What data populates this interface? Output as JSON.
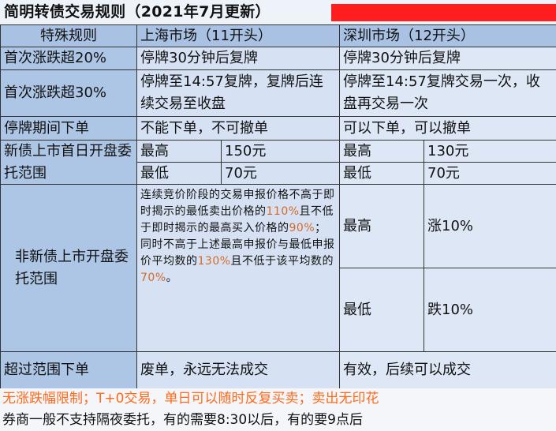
{
  "title": "简明转债交易规则（2021年7月更新）",
  "header": {
    "col1": "特殊规则",
    "col2": "上海市场（11开头）",
    "col3": "深圳市场（12开头）"
  },
  "rows": {
    "r20": {
      "label": "首次涨跌超20%",
      "sh": "停牌30分钟后复牌",
      "sz": "停牌30分钟后复牌"
    },
    "r30": {
      "label": "首次涨跌超30%",
      "sh": "停牌至14:57复牌，复牌后连续交易至收盘",
      "sz": "停牌至14:57复牌交易一次，收盘再交易一次"
    },
    "halt": {
      "label": "停牌期间下单",
      "sh": "不能下单，不可撤单",
      "sz": "可以下单，可以撤单"
    },
    "newbond": {
      "label": "新债上市首日开盘委托范围",
      "sh_high_label": "最高",
      "sh_high": "150元",
      "sh_low_label": "最低",
      "sh_low": "70元",
      "sz_high_label": "最高",
      "sz_high": "130元",
      "sz_low_label": "最低",
      "sz_low": "70元"
    },
    "nonnew": {
      "label": "非新债上市开盘委托范围",
      "sh_text_1": "连续竞价阶段的交易申报价格不高于即时揭示的最低卖出价格的",
      "sh_pct_1": "110%",
      "sh_text_2": "且不低于即时揭示的最高买入价格的",
      "sh_pct_2": "90%",
      "sh_text_3": "；同时不高于上述最高申报价与最低申报价平均数的",
      "sh_pct_3": "130%",
      "sh_text_4": "且不低于该平均数的",
      "sh_pct_4": "70%",
      "sh_text_5": "。",
      "sz_high_label": "最高",
      "sz_high": "涨10%",
      "sz_low_label": "最低",
      "sz_low": "跌10%"
    },
    "over": {
      "label": "超过范围下单",
      "sh": "废单，永远无法成交",
      "sz": "有效，后续可以成交"
    }
  },
  "footer": {
    "line1": "无涨跌幅限制；T+0交易，单日可以随时反复买卖；卖出无印花",
    "line2": "券商一般不支持隔夜委托，有的需要8:30以后，有的要9点后"
  },
  "colors": {
    "highlight": "#d46a26",
    "footer_orange": "#ff6a1a",
    "title_bar": "#ff1e1e",
    "header_bg": "#a9c1e3"
  }
}
